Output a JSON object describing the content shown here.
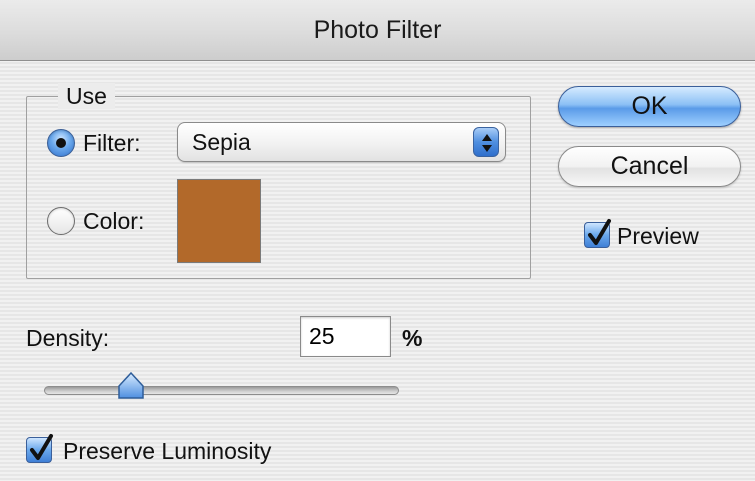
{
  "window": {
    "title": "Photo Filter"
  },
  "use_group": {
    "legend": "Use",
    "filter_option": {
      "label": "Filter:",
      "selected": true
    },
    "filter_select": {
      "value": "Sepia"
    },
    "color_option": {
      "label": "Color:",
      "selected": false
    },
    "color_swatch": {
      "color": "#b2692a"
    }
  },
  "buttons": {
    "ok": "OK",
    "cancel": "Cancel"
  },
  "preview": {
    "label": "Preview",
    "checked": true
  },
  "density": {
    "label": "Density:",
    "value": "25",
    "unit": "%",
    "slider_level_percent": 25
  },
  "preserve_luminosity": {
    "label": "Preserve Luminosity",
    "checked": true
  },
  "colors": {
    "accent": "#4f8fe0",
    "swatch": "#b2692a"
  }
}
